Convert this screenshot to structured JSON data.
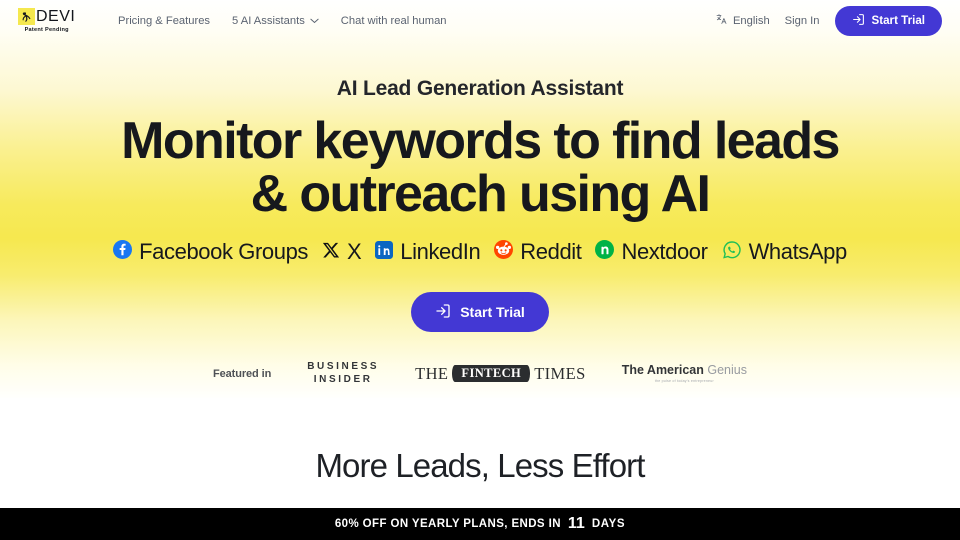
{
  "brand": {
    "name": "DEVI",
    "tagline": "Patent Pending",
    "mark_icon": "devi-figure-icon",
    "mark_bg": "#f5e84e"
  },
  "nav": {
    "links": [
      {
        "label": "Pricing & Features",
        "has_chevron": false
      },
      {
        "label": "5 AI Assistants",
        "has_chevron": true
      },
      {
        "label": "Chat with real human",
        "has_chevron": false
      }
    ],
    "language": {
      "label": "English",
      "icon": "translate-icon"
    },
    "sign_in": "Sign In",
    "start_trial": {
      "label": "Start Trial",
      "icon": "login-arrow-icon",
      "color": "#4338d4"
    }
  },
  "hero": {
    "eyebrow": "AI Lead Generation Assistant",
    "heading": "Monitor keywords to find leads & outreach using AI",
    "socials": [
      {
        "label": "Facebook Groups",
        "icon": "facebook-icon",
        "color": "#1877f2"
      },
      {
        "label": "X",
        "icon": "x-twitter-icon",
        "color": "#000000"
      },
      {
        "label": "LinkedIn",
        "icon": "linkedin-icon",
        "color": "#0a66c2"
      },
      {
        "label": "Reddit",
        "icon": "reddit-icon",
        "color": "#ff4500"
      },
      {
        "label": "Nextdoor",
        "icon": "nextdoor-icon",
        "color": "#00b246"
      },
      {
        "label": "WhatsApp",
        "icon": "whatsapp-icon",
        "color": "#25d366"
      }
    ],
    "cta": {
      "label": "Start Trial",
      "icon": "login-arrow-icon",
      "color": "#4338d4"
    }
  },
  "featured": {
    "label": "Featured in",
    "logos": [
      {
        "name": "Business Insider",
        "line1": "BUSINESS",
        "line2": "INSIDER"
      },
      {
        "name": "The Fintech Times",
        "pre": "THE",
        "pill": "FINTECH",
        "post": "TIMES"
      },
      {
        "name": "The American Genius",
        "strong": "The American",
        "light": "Genius",
        "sub": "the pulse of today's entrepreneur"
      }
    ]
  },
  "section2": {
    "heading": "More Leads, Less Effort"
  },
  "banner": {
    "text": "60% OFF ON YEARLY PLANS, ENDS IN",
    "days_number": "11",
    "days_label": "DAYS",
    "bg": "#000000"
  }
}
